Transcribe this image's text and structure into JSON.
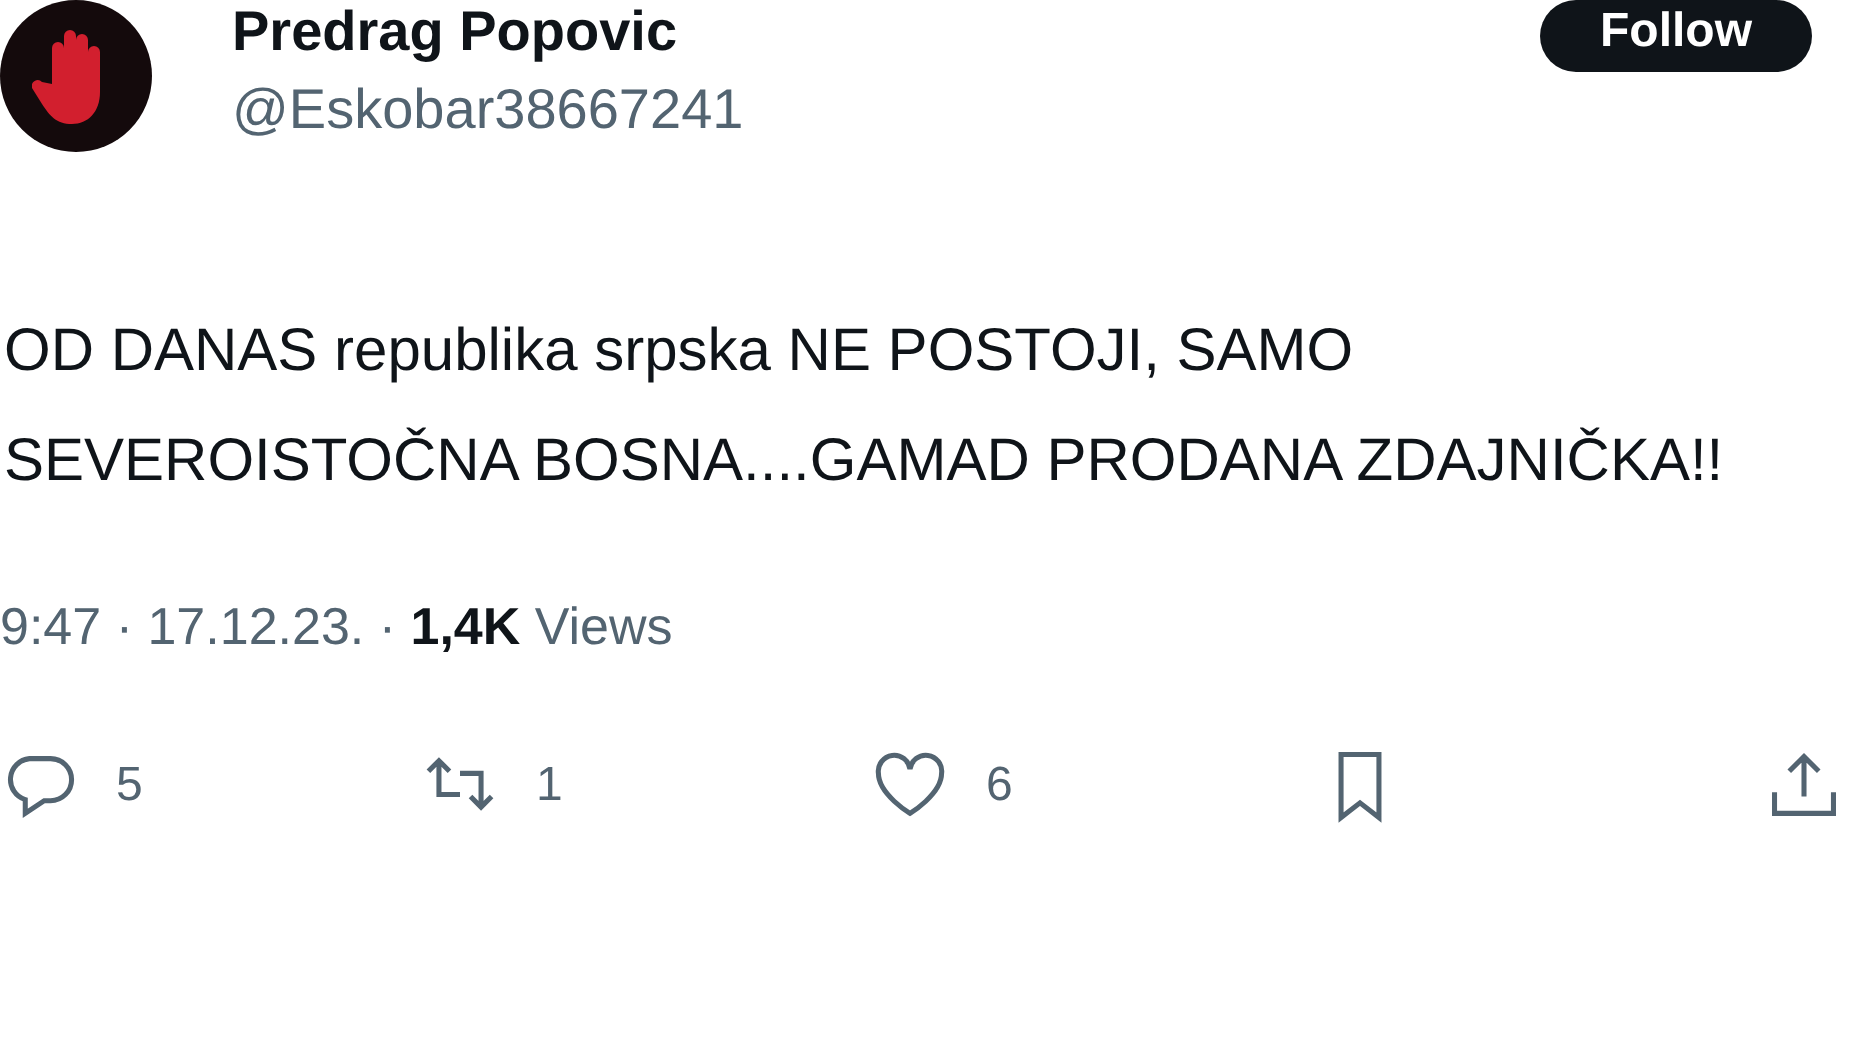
{
  "author": {
    "name": "Predrag Popovic",
    "handle": "@Eskobar38667241"
  },
  "follow_button": {
    "label": "Follow"
  },
  "tweet": {
    "text": "OD DANAS republika srpska NE POSTOJI, SAMO SEVEROISTOČNA BOSNA....GAMAD PRODANA ZDAJNIČKA!!",
    "meta": "9:47 · 17.12.23. · **1,4K** Views"
  },
  "actions": [
    {
      "kind": "reply",
      "count": "5"
    },
    {
      "kind": "retweet",
      "count": "1"
    },
    {
      "kind": "like",
      "count": "6"
    },
    {
      "kind": "bookmark"
    },
    {
      "kind": "share"
    }
  ]
}
